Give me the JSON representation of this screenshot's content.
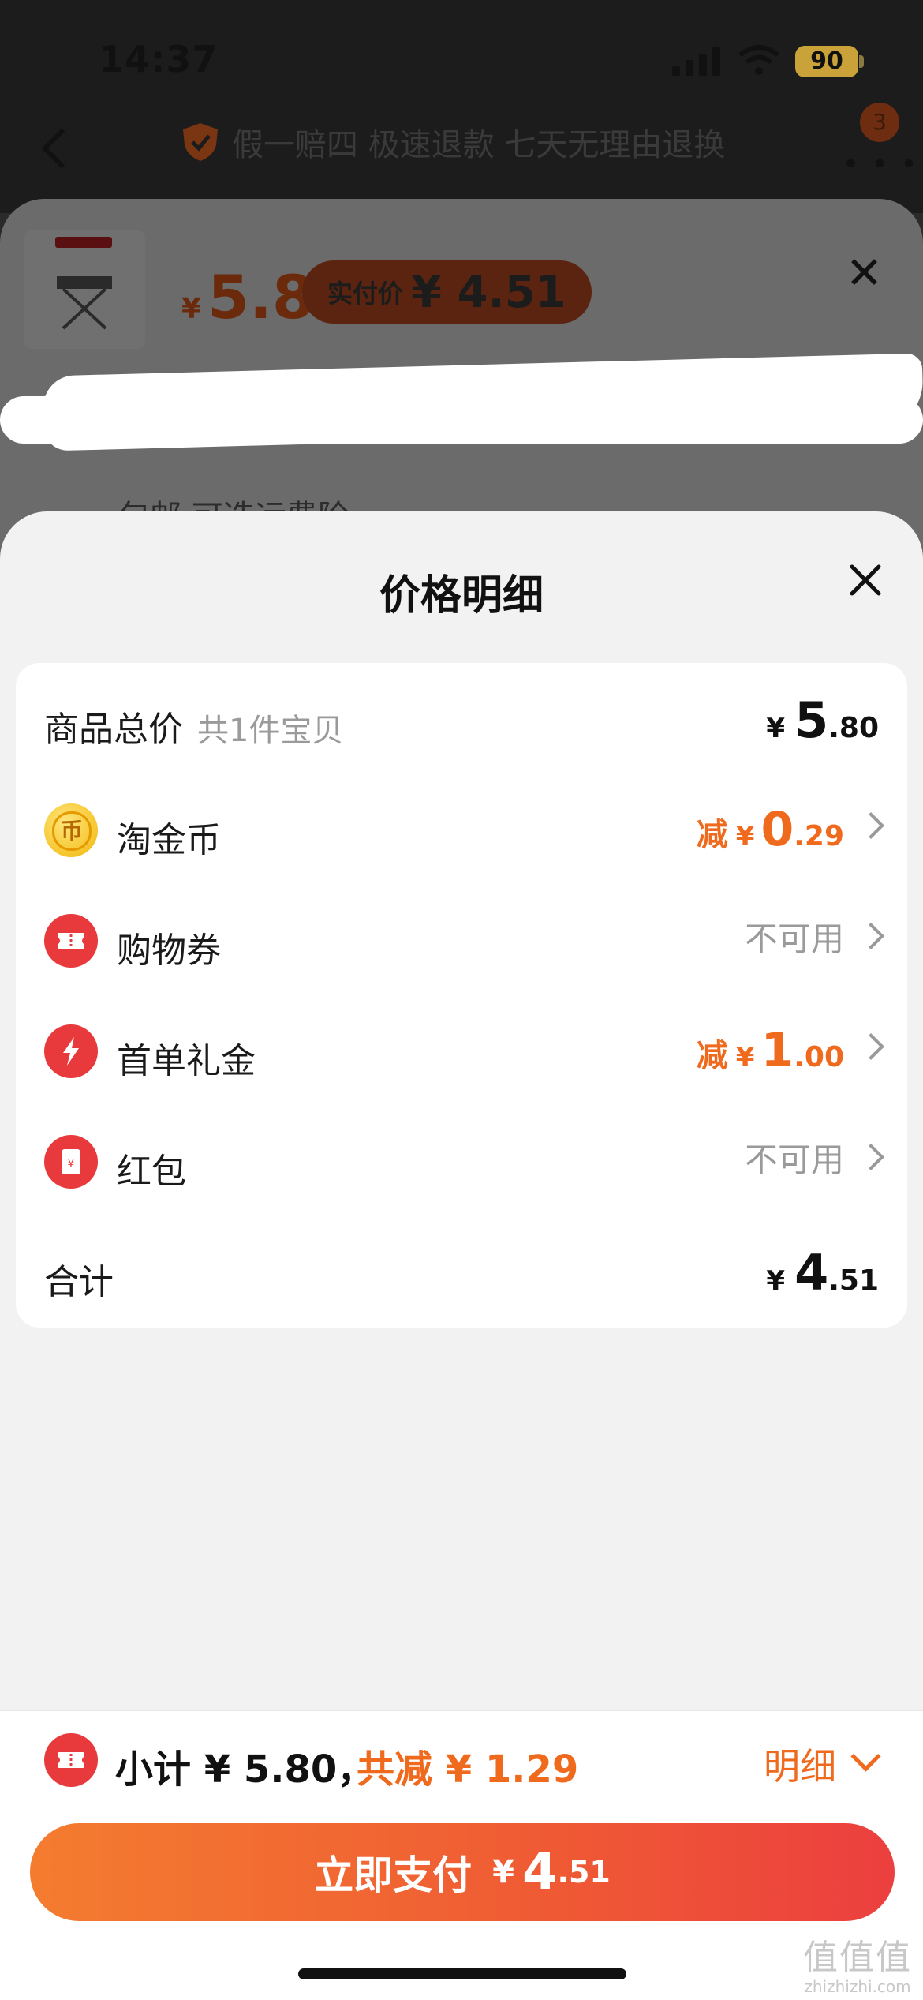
{
  "status_bar": {
    "time": "14:37",
    "battery": "90"
  },
  "nav": {
    "guarantee": "假一赔四 极速退款 七天无理由退换",
    "cart_badge": "3"
  },
  "sku": {
    "price_yen": "¥",
    "price": "5.8",
    "paid_label": "实付价",
    "paid_value": "¥ 4.51",
    "shipping": "包邮  可选运费险"
  },
  "sheet": {
    "title": "价格明细",
    "rows": [
      {
        "label": "商品总价",
        "sub": "共1件宝贝",
        "yen": "¥",
        "int": "5",
        "dec": ".80"
      },
      {
        "label": "淘金币",
        "icon": "coin-icon",
        "prefix": "减",
        "yen": "¥",
        "int": "0",
        "dec": ".29"
      },
      {
        "label": "购物券",
        "icon": "ticket-icon",
        "status": "不可用"
      },
      {
        "label": "首单礼金",
        "icon": "lightning-icon",
        "prefix": "减",
        "yen": "¥",
        "int": "1",
        "dec": ".00"
      },
      {
        "label": "红包",
        "icon": "red-packet-icon",
        "status": "不可用"
      },
      {
        "label": "合计",
        "yen": "¥",
        "int": "4",
        "dec": ".51"
      }
    ]
  },
  "bottom": {
    "subtotal": "小计 ¥ 5.80，",
    "saved": "共减 ¥ 1.29",
    "detail": "明细",
    "pay_label": "立即支付",
    "pay_yen": "¥",
    "pay_int": "4",
    "pay_dec": ".51"
  },
  "watermark": {
    "top": "值值值",
    "bottom": "zhizhizhi.com"
  },
  "colors": {
    "accent": "#f06a1e",
    "danger": "#e83a3d",
    "coin": "#f1b70c",
    "button_start": "#f47c2f",
    "button_end": "#ec3f3f"
  }
}
